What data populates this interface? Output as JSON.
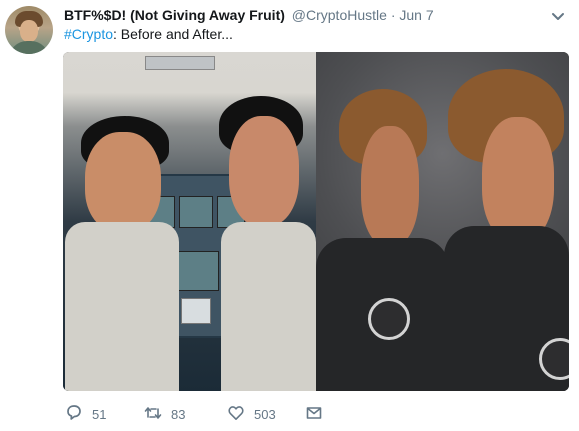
{
  "tweet": {
    "display_name": "BTF%$D! (Not Giving Away Fruit)",
    "handle": "@CryptoHustle",
    "separator": "·",
    "date": "Jun 7",
    "hashtag": "#Crypto",
    "text": ": Before and After..."
  },
  "actions": {
    "reply_count": "51",
    "retweet_count": "83",
    "like_count": "503"
  },
  "colors": {
    "accent": "#1b95e0",
    "muted": "#657786",
    "text": "#14171a"
  },
  "icons": {
    "avatar": "avatar",
    "chevron": "chevron-down-icon",
    "reply": "reply-icon",
    "retweet": "retweet-icon",
    "like": "heart-icon",
    "message": "envelope-icon"
  }
}
